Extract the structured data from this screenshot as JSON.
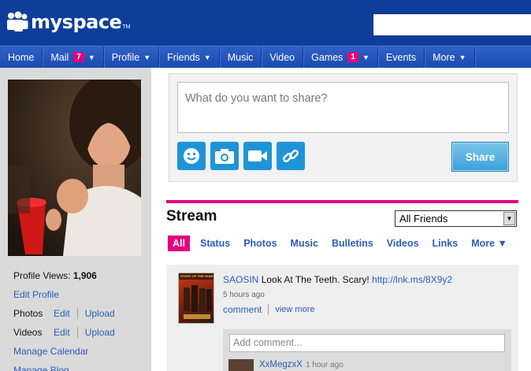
{
  "header": {
    "logo_text": "myspace",
    "logo_tm": "TM",
    "brand_color": "#0e3e9c",
    "search_placeholder": ""
  },
  "nav": [
    {
      "label": "Home"
    },
    {
      "label": "Mail",
      "badge": "7",
      "dropdown": true
    },
    {
      "label": "Profile",
      "dropdown": true
    },
    {
      "label": "Friends",
      "dropdown": true
    },
    {
      "label": "Music"
    },
    {
      "label": "Video"
    },
    {
      "label": "Games",
      "badge": "1",
      "dropdown": true
    },
    {
      "label": "Events"
    },
    {
      "label": "More",
      "dropdown": true
    }
  ],
  "sidebar": {
    "profile_views_label": "Profile Views:",
    "profile_views_count": "1,906",
    "edit_profile": "Edit Profile",
    "photos_label": "Photos",
    "photos_edit": "Edit",
    "photos_upload": "Upload",
    "videos_label": "Videos",
    "videos_edit": "Edit",
    "videos_upload": "Upload",
    "manage_calendar": "Manage Calendar",
    "manage_blog": "Manage Blog"
  },
  "share": {
    "placeholder": "What do you want to share?",
    "button_label": "Share",
    "tools": [
      "smiley-icon",
      "camera-icon",
      "video-camera-icon",
      "link-icon"
    ],
    "tool_color": "#1e94d8"
  },
  "stream": {
    "title": "Stream",
    "accent_color": "#e4007c",
    "filter_selected": "All Friends",
    "tabs": [
      "All",
      "Status",
      "Photos",
      "Music",
      "Bulletins",
      "Videos",
      "Links",
      "More ▼"
    ],
    "active_tab": "All",
    "post": {
      "thumb_caption": "STORY OF THE YEAR",
      "author": "SAOSIN",
      "text": "Look At The Teeth. Scary!",
      "link": "http://lnk.ms/8X9y2",
      "time": "5 hours ago",
      "comment_label": "comment",
      "view_more_label": "view more",
      "comment_placeholder": "Add comment...",
      "commenter": "XxMegzxX",
      "comment_time": "1 hour ago"
    }
  }
}
